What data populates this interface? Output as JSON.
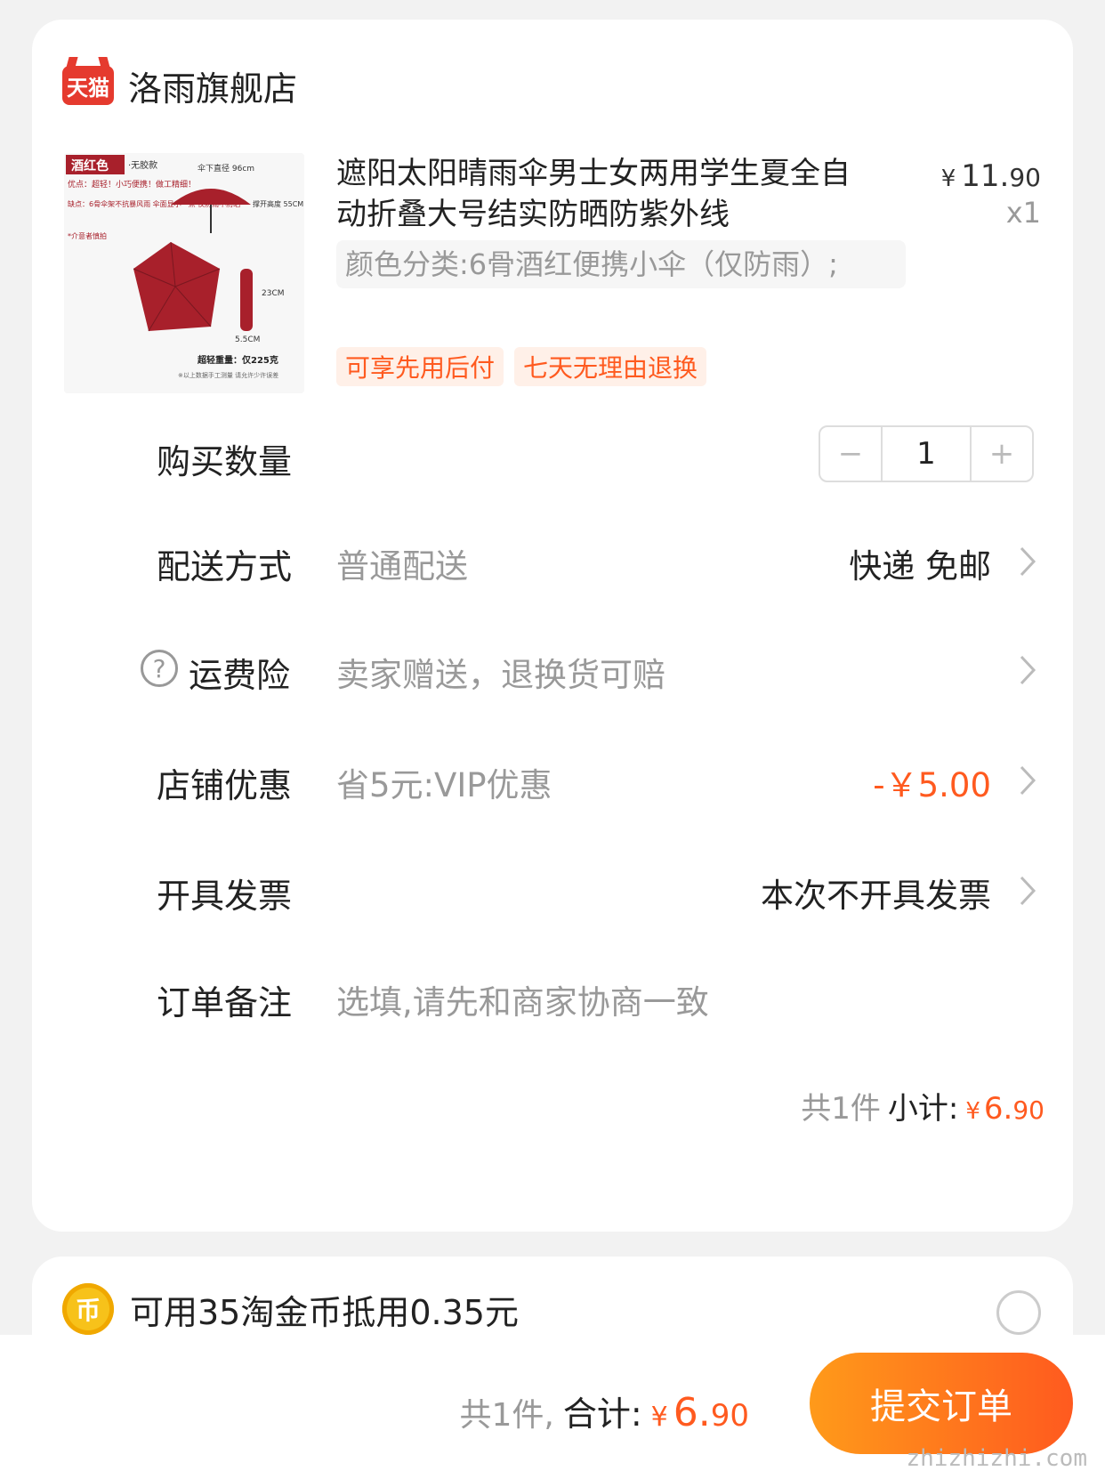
{
  "store": {
    "logo_text": "天猫",
    "name": "洛雨旗舰店"
  },
  "product": {
    "title": "遮阳太阳晴雨伞男士女两用学生夏全自动折叠大号结实防晒防紫外线",
    "price_yen": "¥",
    "price_int": "11.",
    "price_dec": "90",
    "qty": "x1",
    "sku": "颜色分类:6骨酒红便携小伞（仅防雨）;",
    "tags": [
      "可享先用后付",
      "七天无理由退换"
    ],
    "thumb": {
      "badge": "酒红色",
      "badge_note": "·无胶款",
      "pros": "优点：超轻！小巧便携！做工精细！",
      "cons": "缺点：6骨伞架不抗暴风雨 伞面显小一点 仅防雨不防晒",
      "notice": "*介意者慎拍",
      "dim_top": "伞下直径 96cm",
      "dim_side": "撑开高度 55CM",
      "dim_len": "23CM",
      "dim_width": "5.5CM",
      "weight": "超轻重量：仅225克",
      "footnote": "※以上数据手工测量 请允许少许误差",
      "umbrella_color": "#a8202b"
    }
  },
  "rows": {
    "quantity": {
      "label": "购买数量",
      "minus": "−",
      "value": "1",
      "plus": "+"
    },
    "delivery": {
      "label": "配送方式",
      "sub": "普通配送",
      "value": "快递 免邮"
    },
    "insurance": {
      "label": "运费险",
      "sub": "卖家赠送，退换货可赔",
      "help": "?"
    },
    "discount": {
      "label": "店铺优惠",
      "sub": "省5元:VIP优惠",
      "value": "-￥5.00"
    },
    "invoice": {
      "label": "开具发票",
      "value": "本次不开具发票"
    },
    "note": {
      "label": "订单备注",
      "placeholder": "选填,请先和商家协商一致"
    }
  },
  "subtotal": {
    "count": "共1件",
    "label": "小计:",
    "yen": "¥",
    "int": "6.",
    "dec": "90"
  },
  "coin": {
    "icon_text": "币",
    "text": "可用35淘金币抵用0.35元"
  },
  "bottom": {
    "count": "共1件,",
    "label": "合计:",
    "yen": "¥",
    "int": "6.",
    "dec": "90",
    "submit": "提交订单"
  },
  "watermark": "zhizhizhi.com",
  "colors": {
    "accent": "#ff5a1f",
    "tmall_red": "#e53a2e",
    "coin_gold": "#f7c21a"
  }
}
